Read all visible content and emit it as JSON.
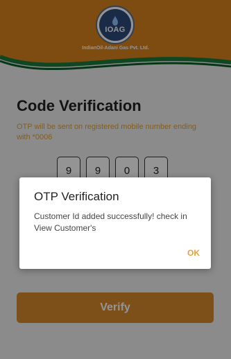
{
  "header": {
    "logo_text": "IOAG",
    "company_name": "IndianOil-Adani Gas Pvt. Ltd."
  },
  "screen": {
    "title": "Code Verification",
    "subtitle": "OTP will be sent on registered mobile number ending with *0006",
    "otp_digits": [
      "9",
      "9",
      "0",
      "3"
    ],
    "verify_label": "Verify"
  },
  "dialog": {
    "title": "OTP Verification",
    "message": "Customer Id added successfully! check in View Customer's",
    "ok_label": "OK"
  },
  "colors": {
    "brand_orange": "#d9831e",
    "accent_green": "#1a7a3c",
    "link_orange": "#e0a23a"
  }
}
